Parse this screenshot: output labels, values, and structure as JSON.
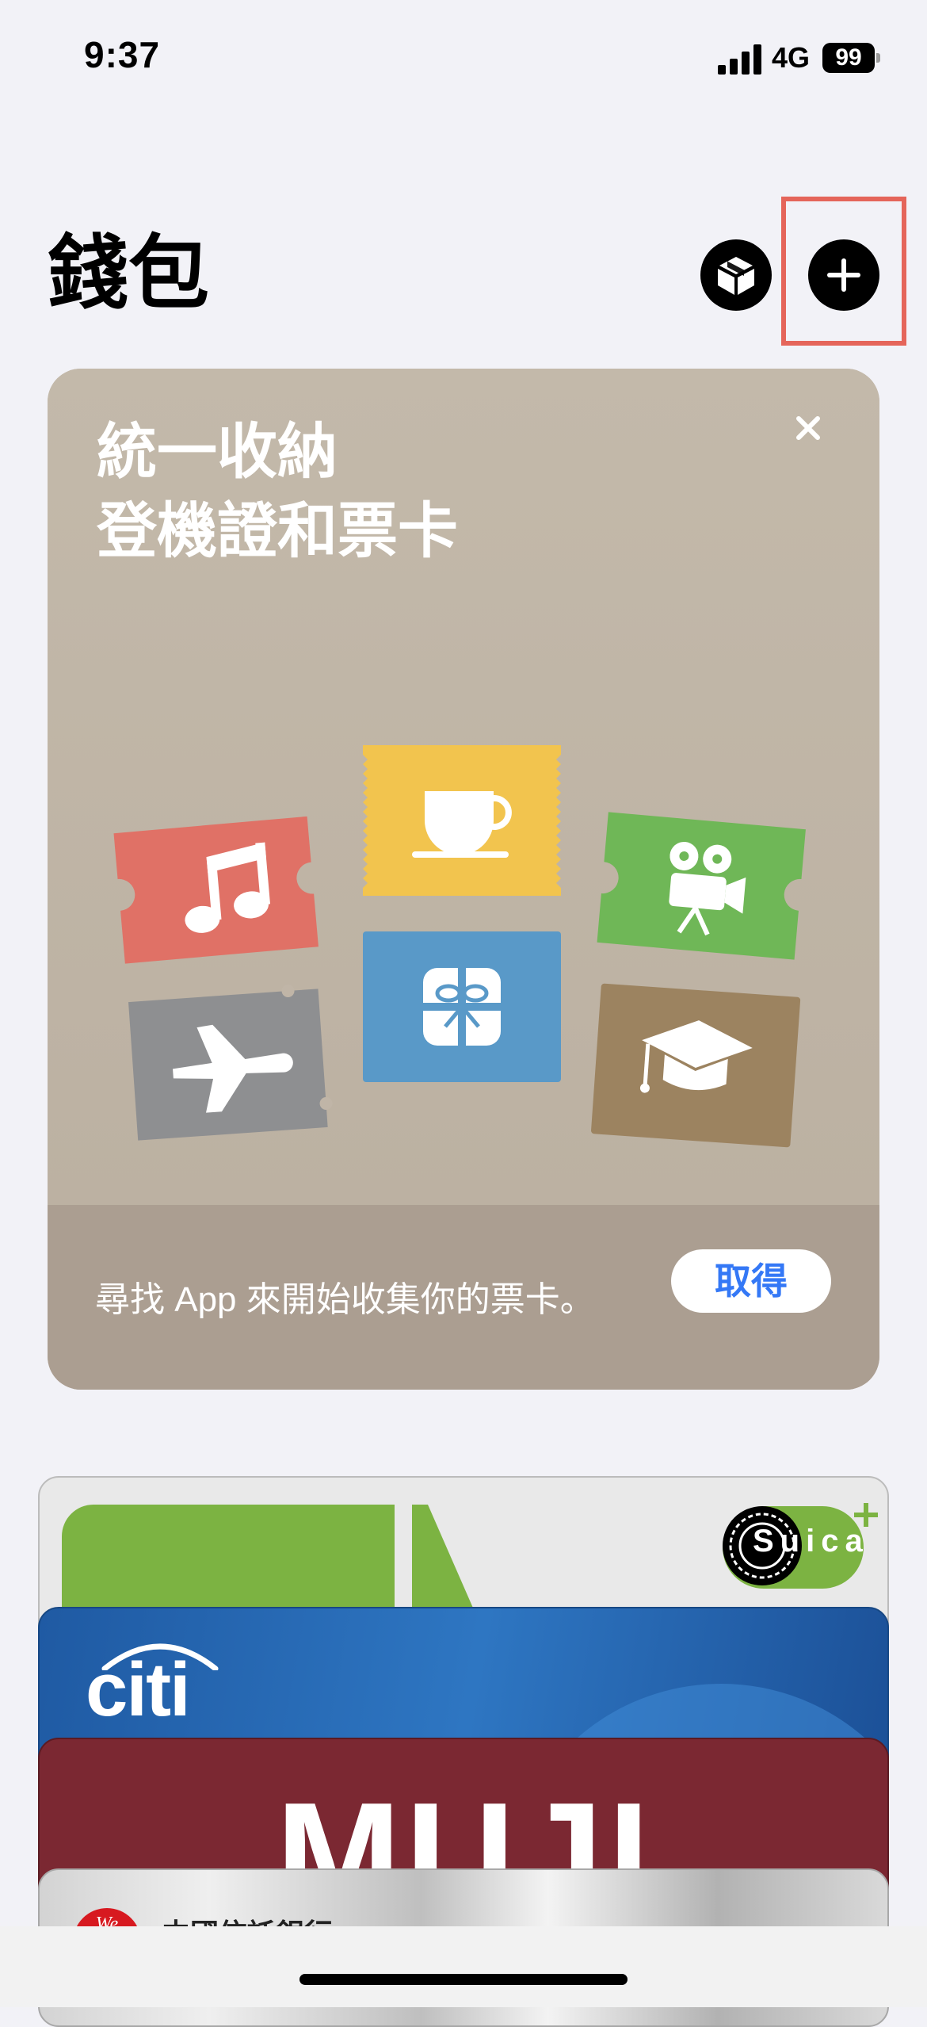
{
  "status_bar": {
    "time": "9:37",
    "network": "4G",
    "battery": "99"
  },
  "header": {
    "title": "錢包"
  },
  "promo": {
    "heading_line1": "統一收納",
    "heading_line2": "登機證和票卡",
    "footer_text": "尋找 App 來開始收集你的票卡。",
    "get_button": "取得",
    "pass_icons": [
      "music-note-icon",
      "coffee-cup-icon",
      "movie-camera-icon",
      "airplane-icon",
      "gift-icon",
      "graduation-cap-icon"
    ]
  },
  "cards": {
    "suica_logo": "Suica",
    "citi_logo": "citi",
    "muji_logo": "MUJI",
    "bank_name": "中國信託銀行",
    "bank_badge": "We"
  },
  "colors": {
    "highlight": "#e5655a",
    "get_button_text": "#3478f6",
    "suica_green": "#7cb342",
    "citi_blue": "#1f5aa3",
    "muji_red": "#7b2832"
  }
}
